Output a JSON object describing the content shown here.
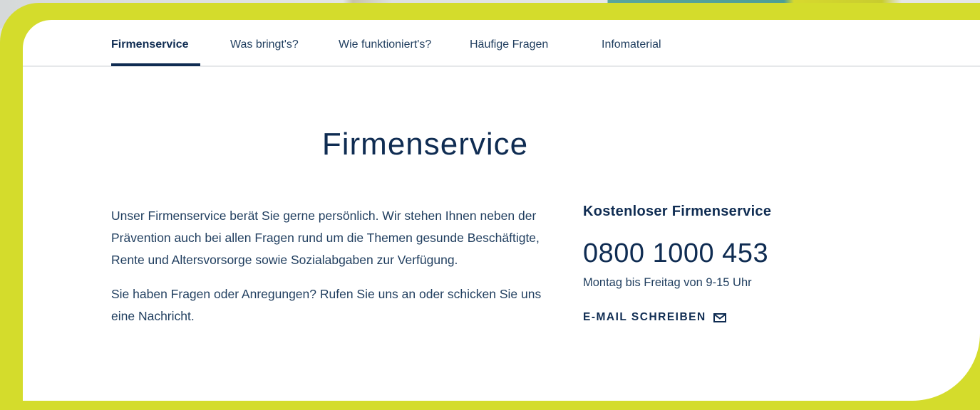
{
  "nav": {
    "items": [
      {
        "label": "Firmenservice",
        "active": true
      },
      {
        "label": "Was bringt's?",
        "active": false
      },
      {
        "label": "Wie funktioniert's?",
        "active": false
      },
      {
        "label": "Häufige Fragen",
        "active": false
      },
      {
        "label": "Infomaterial",
        "active": false
      }
    ]
  },
  "main": {
    "title": "Firmenservice",
    "paragraphs": [
      "Unser Firmenservice berät Sie gerne persönlich. Wir stehen Ihnen neben der Prävention auch bei allen Fragen rund um die Themen gesunde Beschäftigte, Rente und Altersvorsorge sowie Sozialabgaben zur Verfügung.",
      "Sie haben Fragen oder Anregungen? Rufen Sie uns an oder schicken Sie uns eine Nachricht."
    ]
  },
  "contact": {
    "heading": "Kostenloser Firmenservice",
    "phone": "0800 1000 453",
    "hours": "Montag bis Freitag von 9-15 Uhr",
    "email_label": "E-MAIL SCHREIBEN",
    "email_icon": "envelope-icon"
  },
  "colors": {
    "primary": "#0f2c52",
    "frame": "#d4dc2c",
    "background": "#ffffff"
  }
}
